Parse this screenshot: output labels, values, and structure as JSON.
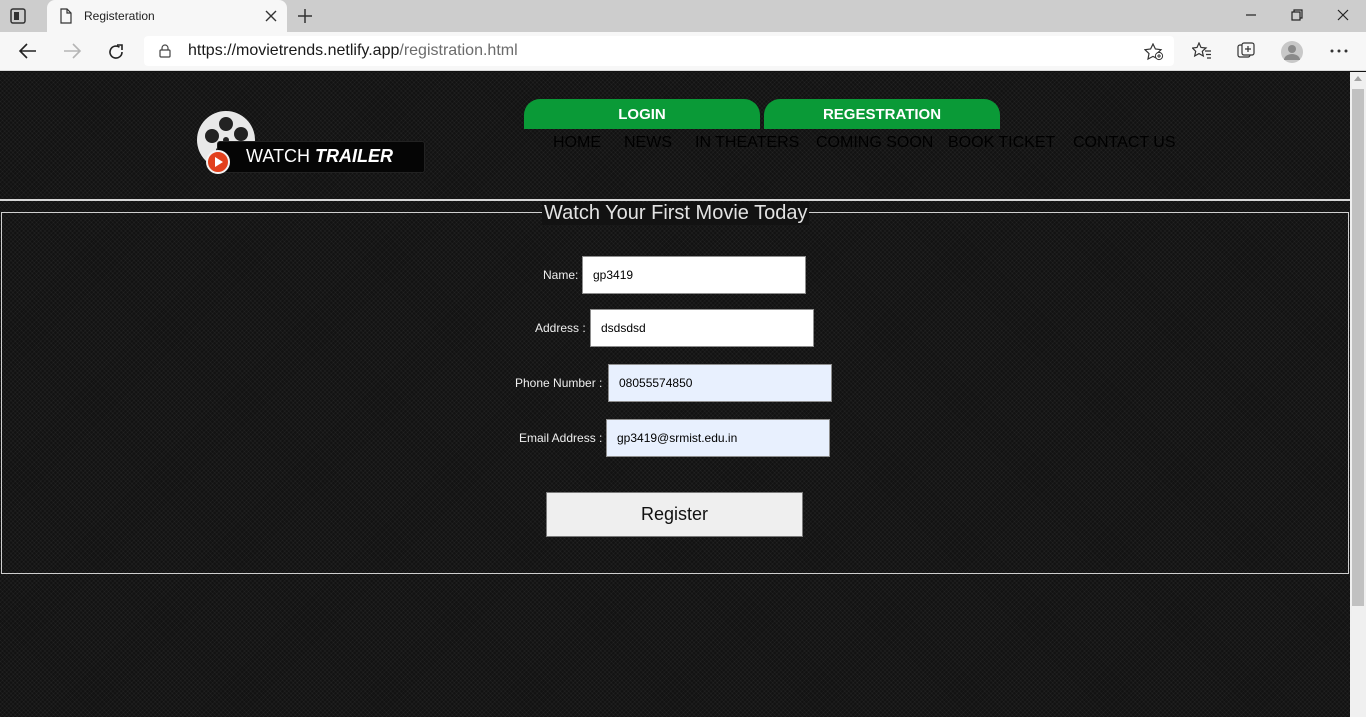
{
  "browser": {
    "tab_title": "Registeration",
    "url_host": "https://movietrends.netlify.app",
    "url_path": "/registration.html"
  },
  "site": {
    "logo_text_plain": "WATCH",
    "logo_text_bold": "TRAILER",
    "top_buttons": [
      "LOGIN",
      "REGESTRATION"
    ],
    "menu": [
      "HOME",
      "NEWS",
      "IN THEATERS",
      "COMING SOON",
      "BOOK TICKET",
      "CONTACT US"
    ],
    "accent_green": "#0a9a37"
  },
  "form": {
    "legend": "Watch Your First Movie Today",
    "fields": [
      {
        "label": "Name:",
        "value": "gp3419"
      },
      {
        "label": "Address :",
        "value": "dsdsdsd"
      },
      {
        "label": "Phone Number :",
        "value": "08055574850"
      },
      {
        "label": "Email Address :",
        "value": "gp3419@srmist.edu.in"
      }
    ],
    "submit_label": "Register"
  }
}
